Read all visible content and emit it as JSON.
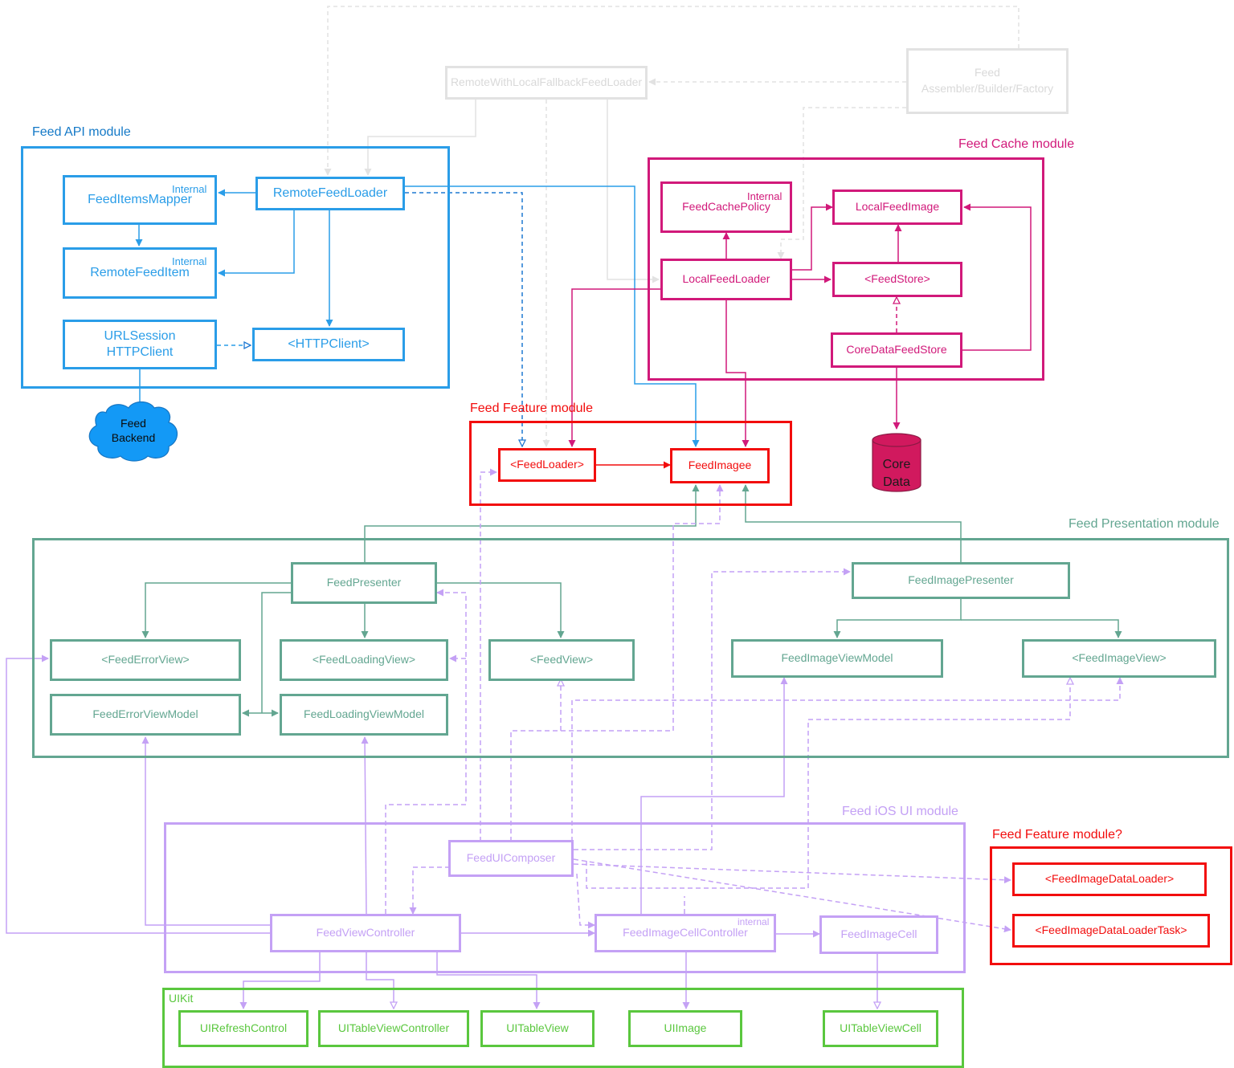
{
  "colors": {
    "api": "#2a9de8",
    "cache": "#d1197a",
    "feature": "#f20d0d",
    "presentation": "#63a691",
    "ios": "#c4a1f5",
    "uikit": "#5ac73e",
    "composition": "#e2e2e2",
    "database_fill": "#d1195e"
  },
  "modules": {
    "api": "Feed API module",
    "cache": "Feed Cache module",
    "feature": "Feed Feature module",
    "presentation": "Feed Presentation module",
    "ios": "Feed iOS UI module",
    "feature2": "Feed Feature module?",
    "uikit": "UIKit"
  },
  "composition": {
    "fallback_loader": "RemoteWithLocalFallbackFeedLoader",
    "factory_line1": "Feed",
    "factory_line2": "Assembler/Builder/Factory"
  },
  "api": {
    "remote_loader": "RemoteFeedLoader",
    "items_mapper": "FeedItemsMapper",
    "remote_item": "RemoteFeedItem",
    "internal1": "Internal",
    "internal2": "Internal",
    "urlsession_line1": "URLSession",
    "urlsession_line2": "HTTPClient",
    "http_client": "<HTTPClient>",
    "backend_line1": "Feed",
    "backend_line2": "Backend"
  },
  "cache": {
    "policy": "FeedCachePolicy",
    "internal": "Internal",
    "local_image": "LocalFeedImage",
    "local_loader": "LocalFeedLoader",
    "store": "<FeedStore>",
    "coredata_store": "CoreDataFeedStore",
    "db_line1": "Core",
    "db_line2": "Data"
  },
  "feature": {
    "loader": "<FeedLoader>",
    "image": "FeedImagee"
  },
  "presentation": {
    "feed_presenter": "FeedPresenter",
    "error_view": "<FeedErrorView>",
    "loading_view": "<FeedLoadingView>",
    "feed_view": "<FeedView>",
    "error_vm": "FeedErrorViewModel",
    "loading_vm": "FeedLoadingViewModel",
    "image_presenter": "FeedImagePresenter",
    "image_vm": "FeedImageViewModel",
    "image_view": "<FeedImageView>"
  },
  "ios": {
    "composer": "FeedUIComposer",
    "view_controller": "FeedViewController",
    "cell_controller": "FeedImageCellController",
    "internal": "internal",
    "image_cell": "FeedImageCell"
  },
  "feature2": {
    "data_loader": "<FeedImageDataLoader>",
    "data_loader_task": "<FeedImageDataLoaderTask>"
  },
  "uikit": {
    "refresh": "UIRefreshControl",
    "tvc": "UITableViewController",
    "table_view": "UITableView",
    "image": "UIImage",
    "cell": "UITableViewCell"
  }
}
